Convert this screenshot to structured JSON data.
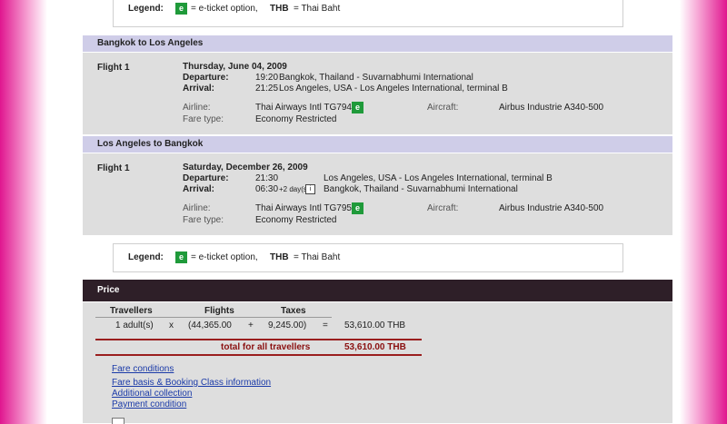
{
  "legend": {
    "title": "Legend:",
    "e_badge": "e",
    "e_desc": "= e-ticket option,",
    "currency_code": "THB",
    "currency_desc": "= Thai Baht"
  },
  "segments": [
    {
      "title": "Bangkok to Los Angeles",
      "flight_label": "Flight 1",
      "date": "Thursday, June 04, 2009",
      "departure_label": "Departure:",
      "departure_time": "19:20",
      "departure_place": "Bangkok, Thailand - Suvarnabhumi International",
      "arrival_label": "Arrival:",
      "arrival_time": "21:25",
      "arrival_days": "",
      "arrival_place": "Los Angeles, USA - Los Angeles International, terminal B",
      "airline_label": "Airline:",
      "airline": "Thai Airways Intl TG794",
      "aircraft_label": "Aircraft:",
      "aircraft": "Airbus Industrie A340-500",
      "fare_label": "Fare type:",
      "fare": "Economy Restricted"
    },
    {
      "title": "Los Angeles to Bangkok",
      "flight_label": "Flight 1",
      "date": "Saturday, December 26, 2009",
      "departure_label": "Departure:",
      "departure_time": "21:30",
      "departure_place": "Los Angeles, USA - Los Angeles International, terminal B",
      "arrival_label": "Arrival:",
      "arrival_time": "06:30",
      "arrival_days": "+2 day(s)",
      "arrival_place": "Bangkok, Thailand - Suvarnabhumi International",
      "airline_label": "Airline:",
      "airline": "Thai Airways Intl TG795",
      "aircraft_label": "Aircraft:",
      "aircraft": "Airbus Industrie A340-500",
      "fare_label": "Fare type:",
      "fare": "Economy Restricted"
    }
  ],
  "price": {
    "header": "Price",
    "col_travellers": "Travellers",
    "col_flights": "Flights",
    "col_taxes": "Taxes",
    "travellers": "1 adult(s)",
    "op_times": "x",
    "flights": "(44,365.00",
    "op_plus": "+",
    "taxes": "9,245.00)",
    "op_eq": "=",
    "subtotal": "53,610.00 THB",
    "total_label": "total for all travellers",
    "total_value": "53,610.00 THB"
  },
  "links": {
    "fare_conditions": "Fare conditions",
    "fare_basis": "Fare basis & Booking Class information",
    "additional": "Additional collection",
    "payment": "Payment condition"
  }
}
